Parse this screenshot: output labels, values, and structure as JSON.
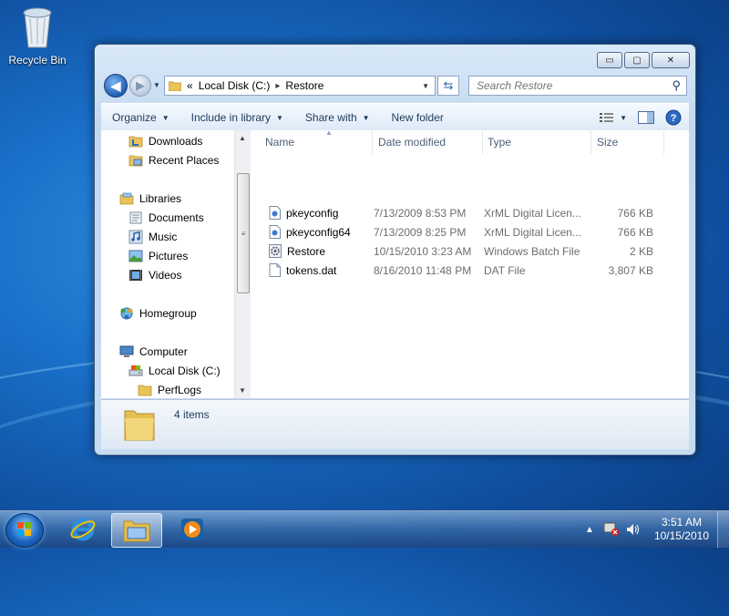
{
  "desktop": {
    "recycle_bin_label": "Recycle Bin"
  },
  "window": {
    "controls": {
      "minimize": "▭",
      "maximize": "▢",
      "close": "✕"
    },
    "address": {
      "overflow": "«",
      "segments": [
        "Local Disk (C:)",
        "Restore"
      ],
      "separator": "▸"
    },
    "search_placeholder": "Search Restore",
    "toolbar": {
      "organize": "Organize",
      "include_in_library": "Include in library",
      "share_with": "Share with",
      "new_folder": "New folder"
    },
    "nav": {
      "downloads": "Downloads",
      "recent_places": "Recent Places",
      "libraries": "Libraries",
      "documents": "Documents",
      "music": "Music",
      "pictures": "Pictures",
      "videos": "Videos",
      "homegroup": "Homegroup",
      "computer": "Computer",
      "local_disk": "Local Disk (C:)",
      "perflogs": "PerfLogs"
    },
    "columns": {
      "name": "Name",
      "date_modified": "Date modified",
      "type": "Type",
      "size": "Size"
    },
    "files": [
      {
        "name": "pkeyconfig",
        "date": "7/13/2009 8:53 PM",
        "type": "XrML Digital Licen...",
        "size": "766 KB",
        "icon": "xrml-icon"
      },
      {
        "name": "pkeyconfig64",
        "date": "7/13/2009 8:25 PM",
        "type": "XrML Digital Licen...",
        "size": "766 KB",
        "icon": "xrml-icon"
      },
      {
        "name": "Restore",
        "date": "10/15/2010 3:23 AM",
        "type": "Windows Batch File",
        "size": "2 KB",
        "icon": "batch-icon"
      },
      {
        "name": "tokens.dat",
        "date": "8/16/2010 11:48 PM",
        "type": "DAT File",
        "size": "3,807 KB",
        "icon": "file-icon"
      }
    ],
    "details": {
      "item_count": "4 items"
    }
  },
  "taskbar": {
    "clock_time": "3:51 AM",
    "clock_date": "10/15/2010"
  }
}
